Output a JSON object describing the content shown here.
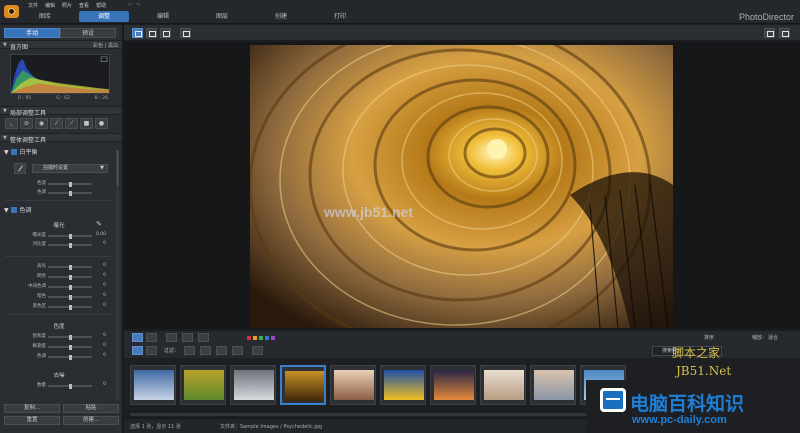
{
  "app": {
    "brand": "PhotoDirector"
  },
  "menu": [
    "文件",
    "编辑",
    "照片",
    "查看",
    "帮助"
  ],
  "workspace_tabs": [
    {
      "label": "图库",
      "active": false
    },
    {
      "label": "调整",
      "active": true
    },
    {
      "label": "编辑",
      "active": false
    },
    {
      "label": "图层",
      "active": false
    },
    {
      "label": "创建",
      "active": false
    },
    {
      "label": "打印",
      "active": false
    }
  ],
  "left_panel": {
    "mode_tabs": [
      {
        "label": "手动",
        "active": true
      },
      {
        "label": "预设",
        "active": false
      }
    ],
    "histogram": {
      "title": "直方图",
      "opt1": "彩色",
      "opt2": "黑白",
      "r": "R : 95",
      "g": "G : 62",
      "b": "B : 26"
    },
    "regional_tools": {
      "title": "局部调整工具"
    },
    "global_tools": {
      "title": "整体调整工具"
    },
    "white_balance": {
      "title": "白平衡",
      "preset": "拍摄时设置",
      "sliders": [
        {
          "label": "色温",
          "value": 0.5
        },
        {
          "label": "色调",
          "value": 0.5
        }
      ]
    },
    "tone": {
      "title": "色调",
      "auto_label": "曝光",
      "exposure": [
        {
          "label": "曝光度",
          "value": "0.00",
          "pos": 0.5
        },
        {
          "label": "对比度",
          "value": "0",
          "pos": 0.5
        }
      ],
      "ranges": [
        {
          "label": "高光",
          "value": "0",
          "pos": 0.5
        },
        {
          "label": "明亮",
          "value": "0",
          "pos": 0.5
        },
        {
          "label": "中间色调",
          "value": "0",
          "pos": 0.5
        },
        {
          "label": "暗色",
          "value": "0",
          "pos": 0.5
        },
        {
          "label": "黑色区",
          "value": "0",
          "pos": 0.5
        }
      ],
      "color_label": "色度",
      "color": [
        {
          "label": "饱和度",
          "value": "0",
          "pos": 0.5
        },
        {
          "label": "鲜艳度",
          "value": "0",
          "pos": 0.5
        },
        {
          "label": "色调",
          "value": "0",
          "pos": 0.5
        }
      ],
      "noise_label": "去噪",
      "noise": [
        {
          "label": "数量",
          "value": "0",
          "pos": 0.5
        }
      ]
    },
    "buttons": {
      "copy": "复制...",
      "paste": "粘贴",
      "reset": "重置",
      "create": "创建..."
    }
  },
  "filmstrip_bar": {
    "filter_label": "过滤：",
    "search": "搜索照片",
    "zoom_label": "缩放：",
    "zoom_value": "适合",
    "sort_label": "排序"
  },
  "swatches": [
    "#d0322c",
    "#e6a12a",
    "#3bb24a",
    "#3a77c9",
    "#9b49c5"
  ],
  "thumbnails": [
    {
      "colors": [
        "#3f6aa3",
        "#c7d4e6"
      ]
    },
    {
      "colors": [
        "#b8a12a",
        "#5c8a2c"
      ]
    },
    {
      "colors": [
        "#6f747b",
        "#d7dadf"
      ]
    },
    {
      "colors": [
        "#c69127",
        "#43260a"
      ],
      "selected": true
    },
    {
      "colors": [
        "#e8d0b6",
        "#8d5e46"
      ]
    },
    {
      "colors": [
        "#1f4fa6",
        "#f0c020"
      ]
    },
    {
      "colors": [
        "#2a2646",
        "#e58a3a"
      ]
    },
    {
      "colors": [
        "#e9ddd0",
        "#b89d82"
      ]
    },
    {
      "colors": [
        "#d9c2ad",
        "#8b96a8"
      ]
    },
    {
      "colors": [
        "#4d88c4",
        "#a9c9e6"
      ]
    }
  ],
  "status": {
    "selection": "选择 1 张，显示 11 张",
    "folder": "文件夹：Sample Images / Psychedelic.jpg"
  },
  "watermarks": {
    "center": "www.jb51.net",
    "site_cn": "脚本之家",
    "site_url": "JB51.Net",
    "badge_cn": "电脑百科知识",
    "badge_url": "www.pc-daily.com"
  }
}
